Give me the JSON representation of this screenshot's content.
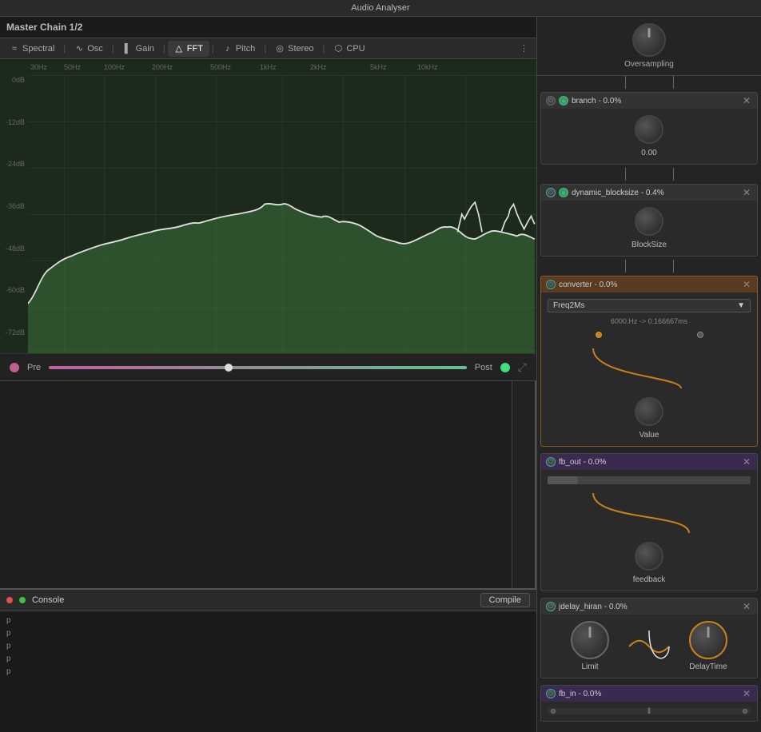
{
  "header": {
    "title": "Audio Analyser"
  },
  "masterChain": {
    "label": "Master Chain 1/2"
  },
  "tabs": [
    {
      "id": "spectral",
      "label": "Spectral",
      "icon": "spectrum",
      "active": false
    },
    {
      "id": "osc",
      "label": "Osc",
      "icon": "wave",
      "active": false
    },
    {
      "id": "gain",
      "label": "Gain",
      "icon": "bar",
      "active": false
    },
    {
      "id": "fft",
      "label": "FFT",
      "icon": "fft",
      "active": true
    },
    {
      "id": "pitch",
      "label": "Pitch",
      "icon": "pitch",
      "active": false
    },
    {
      "id": "stereo",
      "label": "Stereo",
      "icon": "stereo",
      "active": false
    },
    {
      "id": "cpu",
      "label": "CPU",
      "icon": "cpu",
      "active": false
    }
  ],
  "freqLabels": [
    "30Hz",
    "50Hz",
    "100Hz",
    "200Hz",
    "500Hz",
    "1kHz",
    "2kHz",
    "5kHz",
    "10kHz"
  ],
  "dbLabels": [
    "0dB",
    "-12dB",
    "-24dB",
    "-36dB",
    "-48dB",
    "-60dB",
    "-72dB"
  ],
  "controls": {
    "preLabel": "Pre",
    "postLabel": "Post",
    "sliderPosition": 42
  },
  "console": {
    "title": "Console",
    "compileLabel": "Compile",
    "lines": [
      "p",
      "p",
      "p",
      "p",
      "p"
    ]
  },
  "rightPanel": {
    "oversampling": {
      "label": "Oversampling"
    },
    "blocks": [
      {
        "id": "branch",
        "name": "branch - 0.0%",
        "powerActive": false,
        "hasClose": true,
        "knobValue": "0.00"
      },
      {
        "id": "dynamic_blocksize",
        "name": "dynamic_blocksize - 0.4%",
        "powerActive": true,
        "hasClose": true,
        "knobLabel": "BlockSize"
      },
      {
        "id": "converter",
        "name": "converter - 0.0%",
        "powerActive": true,
        "hasClose": true,
        "dropdownValue": "Freq2Ms",
        "info": "6000.Hz -> 0.166667ms",
        "knobLabel": "Value"
      },
      {
        "id": "fb_out",
        "name": "fb_out - 0.0%",
        "powerActive": true,
        "hasClose": true,
        "knobLabel": "feedback"
      },
      {
        "id": "jdelay_hiran",
        "name": "jdelay_hiran - 0.0%",
        "powerActive": true,
        "hasClose": true,
        "knob1Label": "Limit",
        "knob2Label": "DelayTime"
      },
      {
        "id": "fb_in",
        "name": "fb_in - 0.0%",
        "powerActive": true,
        "hasClose": true
      }
    ]
  }
}
